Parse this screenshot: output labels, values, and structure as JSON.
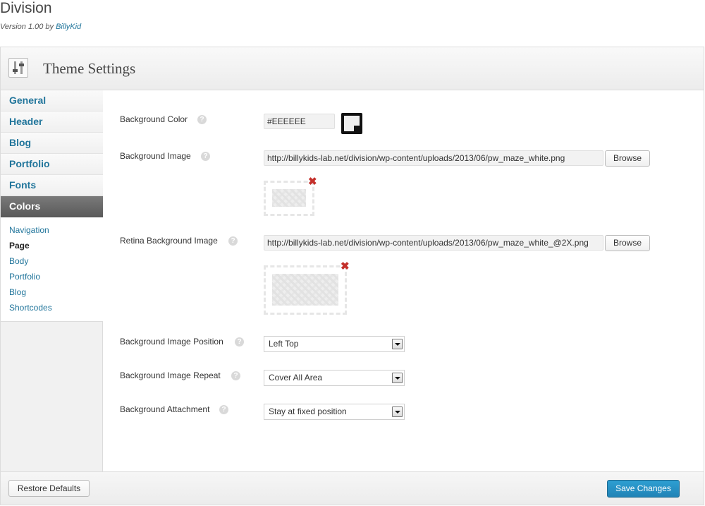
{
  "header": {
    "title": "Division",
    "version_prefix": "Version 1.00 by ",
    "author": "BillyKid"
  },
  "panel": {
    "title": "Theme Settings",
    "icon": "sliders-icon"
  },
  "sidebar": {
    "items": [
      {
        "label": "General"
      },
      {
        "label": "Header"
      },
      {
        "label": "Blog"
      },
      {
        "label": "Portfolio"
      },
      {
        "label": "Fonts"
      },
      {
        "label": "Colors",
        "active": true
      }
    ],
    "subitems": [
      {
        "label": "Navigation"
      },
      {
        "label": "Page",
        "current": true
      },
      {
        "label": "Body"
      },
      {
        "label": "Portfolio"
      },
      {
        "label": "Blog"
      },
      {
        "label": "Shortcodes"
      }
    ]
  },
  "fields": {
    "bg_color": {
      "label": "Background Color",
      "value": "#EEEEEE",
      "swatch": "#eeeeee"
    },
    "bg_image": {
      "label": "Background Image",
      "value": "http://billykids-lab.net/division/wp-content/uploads/2013/06/pw_maze_white.png",
      "button": "Browse"
    },
    "retina_image": {
      "label": "Retina Background Image",
      "value": "http://billykids-lab.net/division/wp-content/uploads/2013/06/pw_maze_white_@2X.png",
      "button": "Browse"
    },
    "position": {
      "label": "Background Image Position",
      "value": "Left Top"
    },
    "repeat": {
      "label": "Background Image Repeat",
      "value": "Cover All Area"
    },
    "attachment": {
      "label": "Background Attachment",
      "value": "Stay at fixed position"
    }
  },
  "help_glyph": "?",
  "remove_glyph": "✖",
  "footer": {
    "restore": "Restore Defaults",
    "save": "Save Changes"
  },
  "colors": {
    "accent": "#21759b",
    "save_button": "#2183b6",
    "remove": "#c4302b",
    "active_nav": "#666666"
  }
}
